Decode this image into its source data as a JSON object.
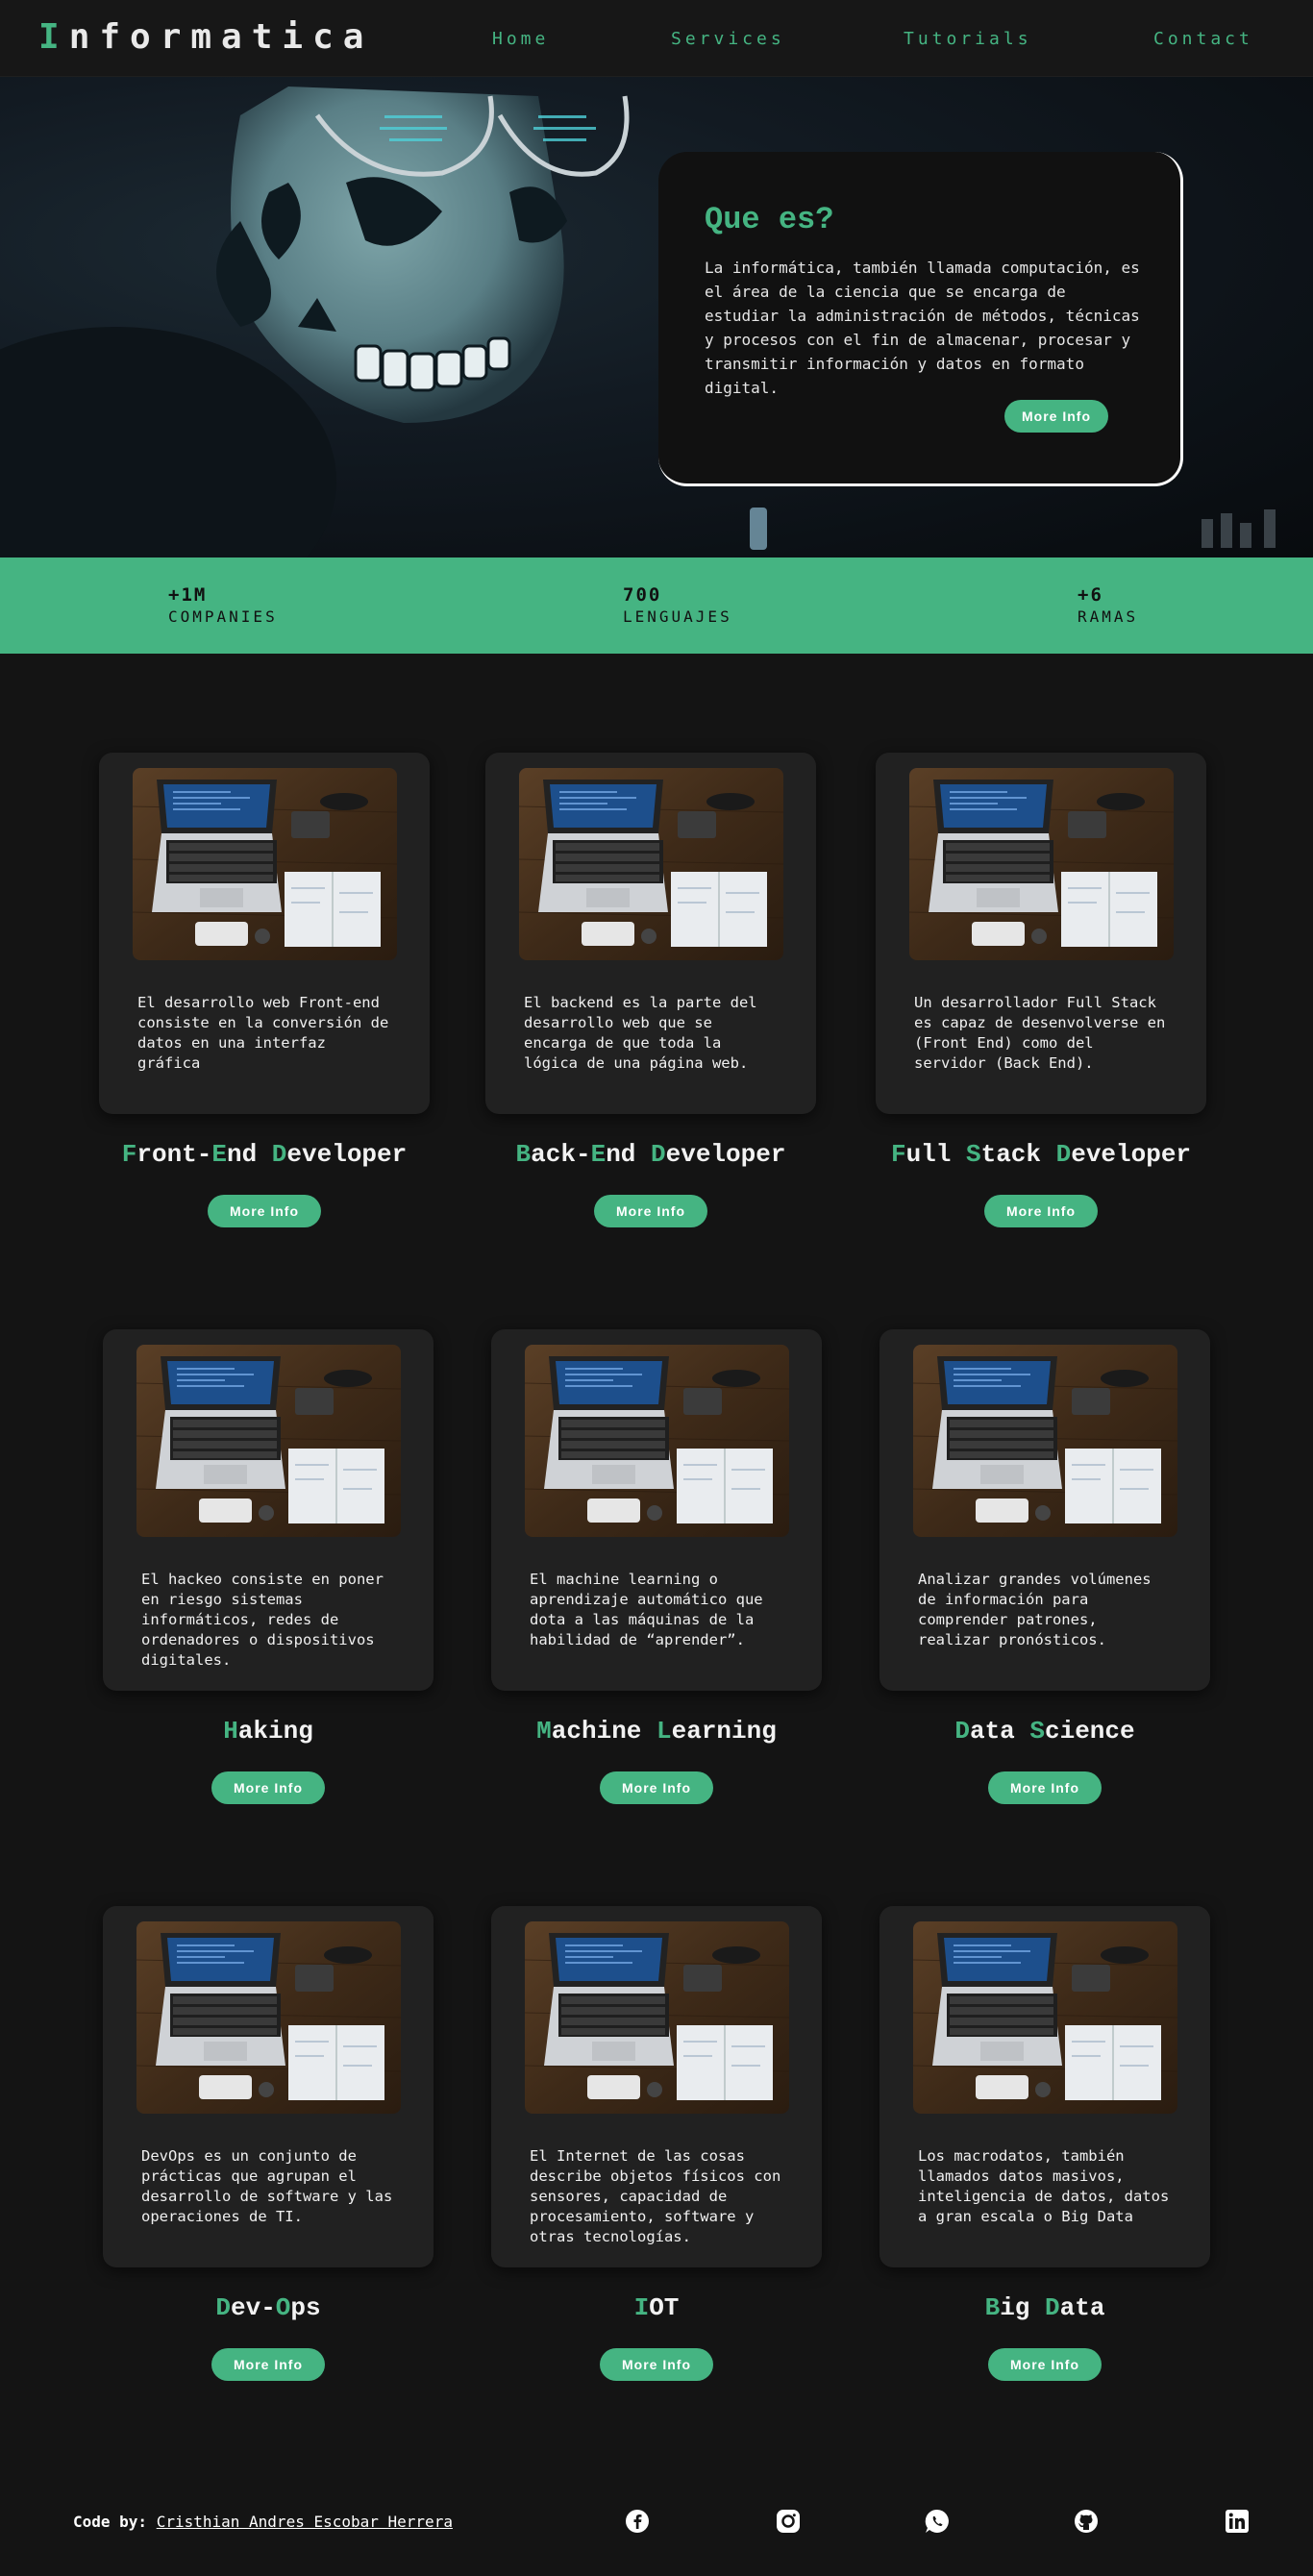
{
  "header": {
    "logo_first": "I",
    "logo_rest": "nformatica",
    "nav": [
      "Home",
      "Services",
      "Tutorials",
      "Contact"
    ]
  },
  "hero": {
    "title": "Que es?",
    "text": "La informática, también llamada computación, es el área de la ciencia que se encarga de estudiar la administración de métodos, técnicas y procesos con el fin de almacenar, procesar y transmitir información y datos en formato digital.",
    "button": "More Info"
  },
  "stats": [
    {
      "number": "+1M",
      "label": "COMPANIES"
    },
    {
      "number": "700",
      "label": "LENGUAJES"
    },
    {
      "number": "+6",
      "label": "RAMAS"
    }
  ],
  "cards": [
    {
      "text": "El desarrollo web Front-end consiste en la conversión de datos en una interfaz gráfica",
      "title": [
        {
          "t": "F",
          "g": true
        },
        {
          "t": "ront-",
          "g": false
        },
        {
          "t": "E",
          "g": true
        },
        {
          "t": "nd ",
          "g": false
        },
        {
          "t": "D",
          "g": true
        },
        {
          "t": "eveloper",
          "g": false
        }
      ],
      "button": "More Info"
    },
    {
      "text": "El backend es la parte del desarrollo web que se encarga de que toda la lógica de una página web.",
      "title": [
        {
          "t": "B",
          "g": true
        },
        {
          "t": "ack-",
          "g": false
        },
        {
          "t": "E",
          "g": true
        },
        {
          "t": "nd ",
          "g": false
        },
        {
          "t": "D",
          "g": true
        },
        {
          "t": "eveloper",
          "g": false
        }
      ],
      "button": "More Info"
    },
    {
      "text": "Un desarrollador Full Stack es capaz de desenvolverse en (Front End) como del servidor (Back End).",
      "title": [
        {
          "t": "F",
          "g": true
        },
        {
          "t": "ull ",
          "g": false
        },
        {
          "t": "S",
          "g": true
        },
        {
          "t": "tack ",
          "g": false
        },
        {
          "t": "D",
          "g": true
        },
        {
          "t": "eveloper",
          "g": false
        }
      ],
      "button": "More Info"
    },
    {
      "text": "El hackeo consiste en poner en riesgo sistemas informáticos, redes de ordenadores o dispositivos digitales.",
      "title": [
        {
          "t": "H",
          "g": true
        },
        {
          "t": "aking",
          "g": false
        }
      ],
      "button": "More Info"
    },
    {
      "text": "El machine learning o aprendizaje automático que dota a las máquinas de la habilidad de “aprender”.",
      "title": [
        {
          "t": "M",
          "g": true
        },
        {
          "t": "achine ",
          "g": false
        },
        {
          "t": "L",
          "g": true
        },
        {
          "t": "earning",
          "g": false
        }
      ],
      "button": "More Info"
    },
    {
      "text": "Analizar grandes volúmenes de información para comprender patrones, realizar pronósticos.",
      "title": [
        {
          "t": "D",
          "g": true
        },
        {
          "t": "ata ",
          "g": false
        },
        {
          "t": "S",
          "g": true
        },
        {
          "t": "cience",
          "g": false
        }
      ],
      "button": "More Info"
    },
    {
      "text": "DevOps es un conjunto de prácticas que agrupan el desarrollo de software y las operaciones de TI.",
      "title": [
        {
          "t": "D",
          "g": true
        },
        {
          "t": "ev-",
          "g": false
        },
        {
          "t": "O",
          "g": true
        },
        {
          "t": "ps",
          "g": false
        }
      ],
      "button": "More Info"
    },
    {
      "text": "El Internet de las cosas describe objetos físicos con sensores, capacidad de procesamiento, software y otras tecnologías.",
      "title": [
        {
          "t": "I",
          "g": true
        },
        {
          "t": "OT",
          "g": false
        }
      ],
      "button": "More Info"
    },
    {
      "text": "Los macrodatos, también llamados datos masivos, inteligencia de datos, datos a gran escala o Big Data",
      "title": [
        {
          "t": "B",
          "g": true
        },
        {
          "t": "ig ",
          "g": false
        },
        {
          "t": "D",
          "g": true
        },
        {
          "t": "ata",
          "g": false
        }
      ],
      "button": "More Info"
    }
  ],
  "footer": {
    "credit_label": "Code by:",
    "credit_name": "Cristhian Andres Escobar Herrera",
    "social": [
      "facebook-icon",
      "instagram-icon",
      "whatsapp-icon",
      "github-icon",
      "linkedin-icon"
    ]
  },
  "colors": {
    "accent": "#45b482",
    "background": "#141414",
    "card": "#212121"
  }
}
